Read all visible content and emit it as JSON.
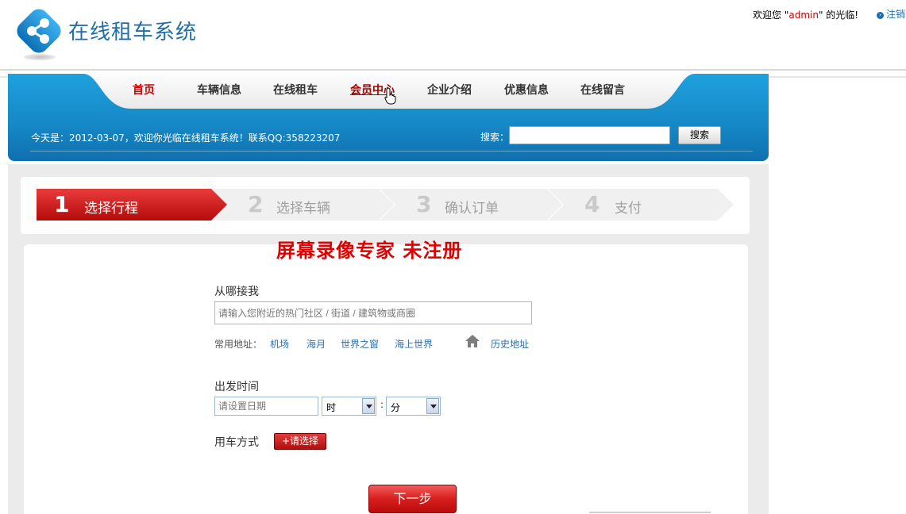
{
  "site": {
    "title": "在线租车系统",
    "welcome_prefix": "欢迎您 \"",
    "user": "admin",
    "welcome_suffix": "\" 的光临!",
    "logout": "注销"
  },
  "nav": {
    "items": [
      {
        "label": "首页",
        "state": "active"
      },
      {
        "label": "车辆信息"
      },
      {
        "label": "在线租车"
      },
      {
        "label": "会员中心",
        "state": "hover"
      },
      {
        "label": "企业介绍"
      },
      {
        "label": "优惠信息"
      },
      {
        "label": "在线留言"
      }
    ]
  },
  "banner": {
    "today_text": "今天是：2012-03-07，欢迎你光临在线租车系统！联系QQ:358223207",
    "search_label": "搜索：",
    "search_value": "",
    "search_button": "搜索"
  },
  "steps": [
    {
      "num": "1",
      "label": "选择行程",
      "active": true
    },
    {
      "num": "2",
      "label": "选择车辆",
      "active": false
    },
    {
      "num": "3",
      "label": "确认订单",
      "active": false
    },
    {
      "num": "4",
      "label": "支付",
      "active": false
    }
  ],
  "watermark": "屏幕录像专家  未注册",
  "form": {
    "pickup_label": "从哪接我",
    "pickup_placeholder": "请输入您附近的热门社区 / 街道 / 建筑物或商圈",
    "common_addr_label": "常用地址：",
    "common_addrs": [
      "机场",
      "海月",
      "世界之窗",
      "海上世界"
    ],
    "history_label": "历史地址",
    "depart_label": "出发时间",
    "date_placeholder": "请设置日期",
    "hour_value": "时",
    "colon": ":",
    "minute_value": "分",
    "mode_label": "用车方式",
    "choose_button": "请选择",
    "next_button": "下一步"
  },
  "colors": {
    "banner_blue": "#1687c6",
    "active_red": "#c00000",
    "link_blue": "#2b6fb3"
  }
}
